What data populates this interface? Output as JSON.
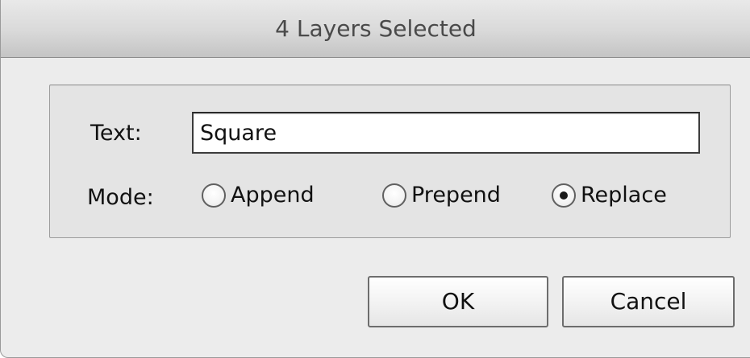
{
  "dialog": {
    "title": "4 Layers Selected"
  },
  "form": {
    "text_label": "Text:",
    "text_value": "Square",
    "mode_label": "Mode:",
    "modes": [
      {
        "label": "Append",
        "checked": false
      },
      {
        "label": "Prepend",
        "checked": false
      },
      {
        "label": "Replace",
        "checked": true
      }
    ]
  },
  "buttons": {
    "ok_label": "OK",
    "cancel_label": "Cancel"
  },
  "colors": {
    "window_bg": "#ececec",
    "groupbox_bg": "#e4e4e4",
    "text": "#111111",
    "title_text": "#4a4a4a"
  }
}
